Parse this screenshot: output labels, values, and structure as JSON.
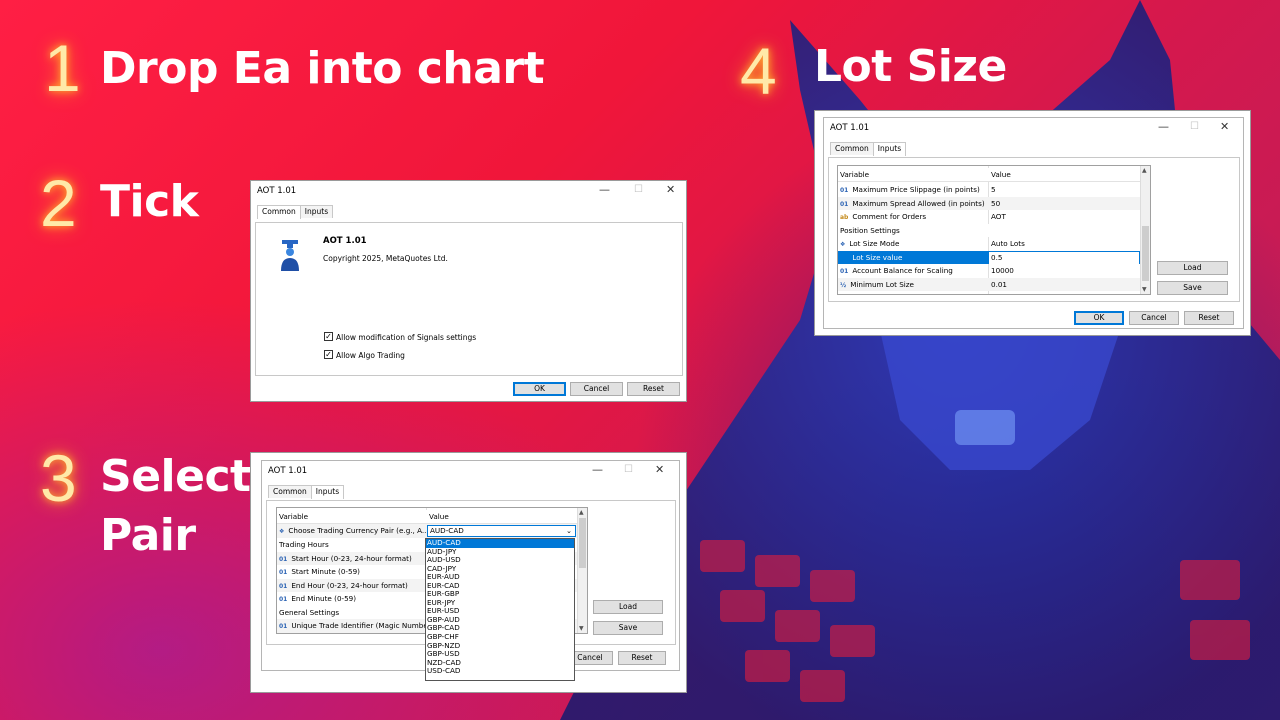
{
  "steps": [
    {
      "number": "1",
      "title": "Drop Ea into chart"
    },
    {
      "number": "2",
      "title": "Tick"
    },
    {
      "number": "3",
      "title_line1": "Select",
      "title_line2": "Pair"
    },
    {
      "number": "4",
      "title": "Lot Size"
    }
  ],
  "window_controls": {
    "minimize": "—",
    "maximize": "☐",
    "close": "✕"
  },
  "tabs": {
    "common": "Common",
    "inputs": "Inputs"
  },
  "buttons": {
    "ok": "OK",
    "cancel": "Cancel",
    "reset": "Reset",
    "load": "Load",
    "save": "Save"
  },
  "dialog_common": {
    "title": "AOT 1.01",
    "ea_name": "AOT 1.01",
    "copyright": "Copyright 2025, MetaQuotes Ltd.",
    "signals_label": "Allow modification of Signals settings",
    "signals_checked": true,
    "algo_label": "Allow Algo Trading",
    "algo_checked": true
  },
  "dialog_pair": {
    "title": "AOT 1.01",
    "header": {
      "variable": "Variable",
      "value": "Value"
    },
    "rows": [
      {
        "type": "enum",
        "variable": "Choose Trading Currency Pair (e.g., A...",
        "value": "AUD-CAD"
      },
      {
        "type": "group",
        "variable": "Trading Hours",
        "value": ""
      },
      {
        "type": "01",
        "variable": "Start Hour (0-23, 24-hour format)",
        "value": ""
      },
      {
        "type": "01",
        "variable": "Start Minute (0-59)",
        "value": ""
      },
      {
        "type": "01",
        "variable": "End Hour (0-23, 24-hour format)",
        "value": ""
      },
      {
        "type": "01",
        "variable": "End Minute (0-59)",
        "value": ""
      },
      {
        "type": "group",
        "variable": "General Settings",
        "value": ""
      },
      {
        "type": "01",
        "variable": "Unique Trade Identifier (Magic Number)",
        "value": ""
      }
    ],
    "dropdown_selected": "AUD-CAD",
    "dropdown_options": [
      "AUD-CAD",
      "AUD-JPY",
      "AUD-USD",
      "CAD-JPY",
      "EUR-AUD",
      "EUR-CAD",
      "EUR-GBP",
      "EUR-JPY",
      "EUR-USD",
      "GBP-AUD",
      "GBP-CAD",
      "GBP-CHF",
      "GBP-NZD",
      "GBP-USD",
      "NZD-CAD",
      "USD-CAD"
    ]
  },
  "dialog_lot": {
    "title": "AOT 1.01",
    "header": {
      "variable": "Variable",
      "value": "Value"
    },
    "rows": [
      {
        "type": "01",
        "variable": "Maximum Price Slippage (in points)",
        "value": "5"
      },
      {
        "type": "01",
        "variable": "Maximum Spread Allowed (in points)",
        "value": "50"
      },
      {
        "type": "ab",
        "variable": "Comment for Orders",
        "value": "AOT"
      },
      {
        "type": "group",
        "variable": "Position Settings",
        "value": ""
      },
      {
        "type": "enum",
        "variable": "Lot Size Mode",
        "value": "Auto Lots"
      },
      {
        "type": "01",
        "variable": "Lot Size value",
        "value": "0.5",
        "selected": true
      },
      {
        "type": "01",
        "variable": "Account Balance for Scaling",
        "value": "10000"
      },
      {
        "type": "½",
        "variable": "Minimum Lot Size",
        "value": "0.01"
      }
    ]
  }
}
